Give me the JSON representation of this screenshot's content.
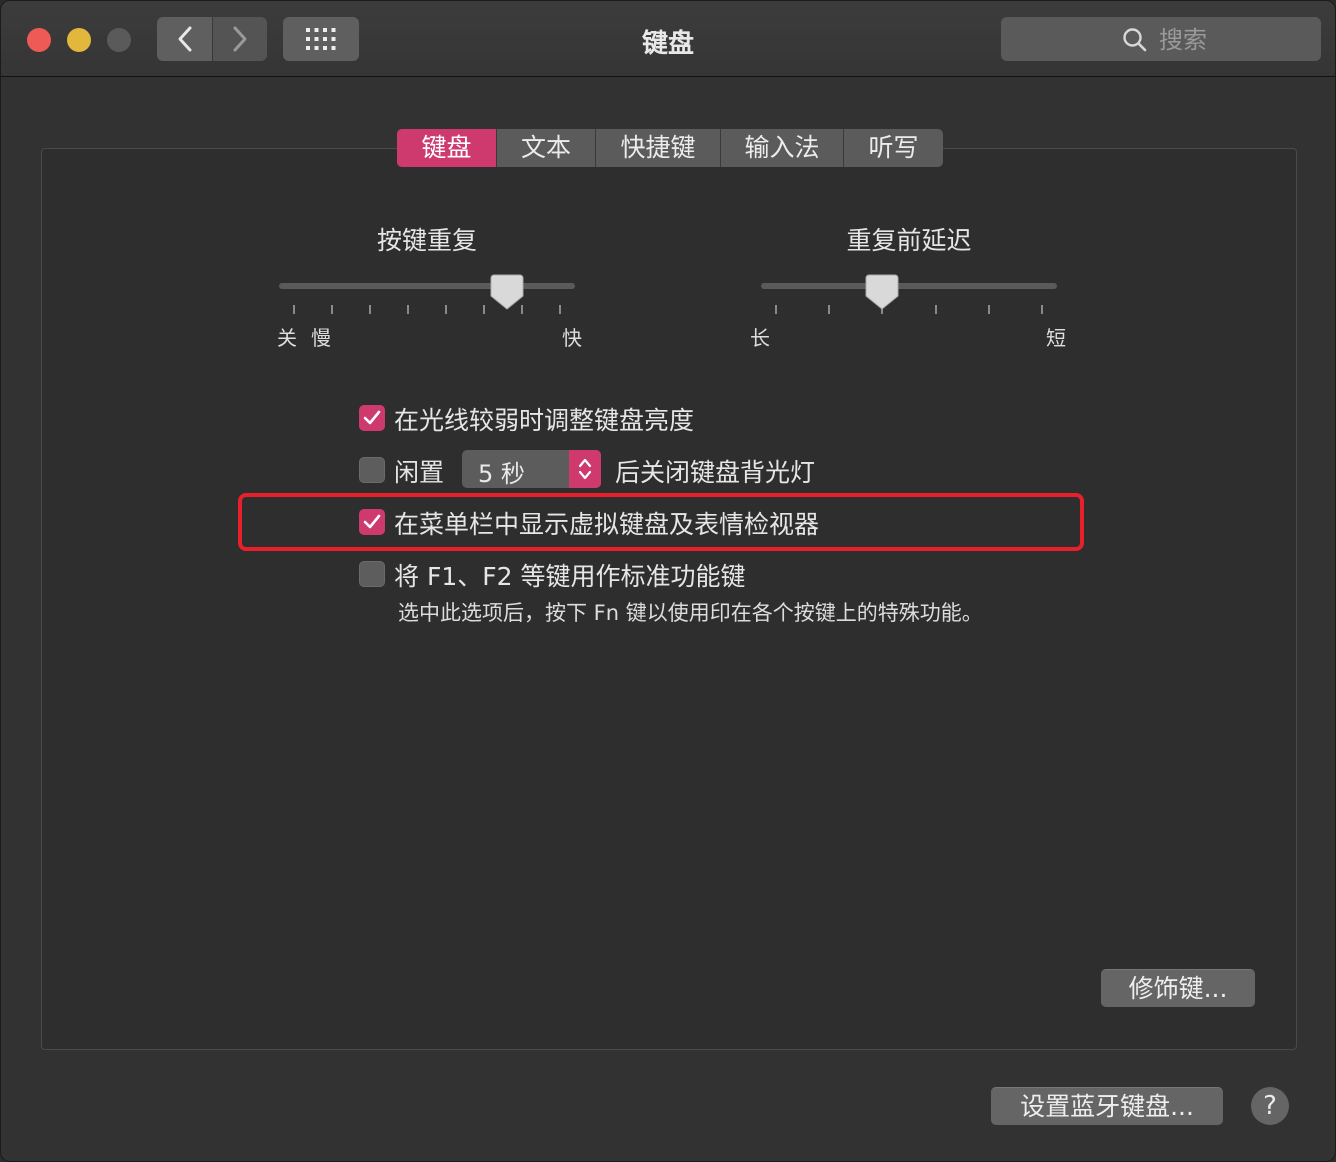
{
  "window": {
    "title": "键盘",
    "search": {
      "placeholder": "搜索",
      "value": ""
    }
  },
  "tabs": [
    {
      "label": "键盘",
      "active": true
    },
    {
      "label": "文本",
      "active": false
    },
    {
      "label": "快捷键",
      "active": false
    },
    {
      "label": "输入法",
      "active": false
    },
    {
      "label": "听写",
      "active": false
    }
  ],
  "key_repeat": {
    "title": "按键重复",
    "label_off": "关",
    "label_slow": "慢",
    "label_fast": "快",
    "level_fraction": 0.8
  },
  "delay_until_repeat": {
    "title": "重复前延迟",
    "label_long": "长",
    "label_short": "短",
    "level_fraction": 0.4
  },
  "options": {
    "adjust_brightness": {
      "label": "在光线较弱时调整键盘亮度",
      "checked": true
    },
    "idle_off": {
      "label_before": "闲置",
      "select_value": "5 秒",
      "label_after": "后关闭键盘背光灯",
      "checked": false
    },
    "show_viewer": {
      "label": "在菜单栏中显示虚拟键盘及表情检视器",
      "checked": true
    },
    "fn_keys": {
      "label": "将 F1、F2 等键用作标准功能键",
      "description": "选中此选项后，按下 Fn 键以使用印在各个按键上的特殊功能。",
      "checked": false
    }
  },
  "buttons": {
    "modifier": "修饰键...",
    "bluetooth": "设置蓝牙键盘...",
    "help": "?"
  },
  "colors": {
    "accent": "#cf3a6e",
    "highlight": "#e8202c",
    "background": "#323232"
  }
}
